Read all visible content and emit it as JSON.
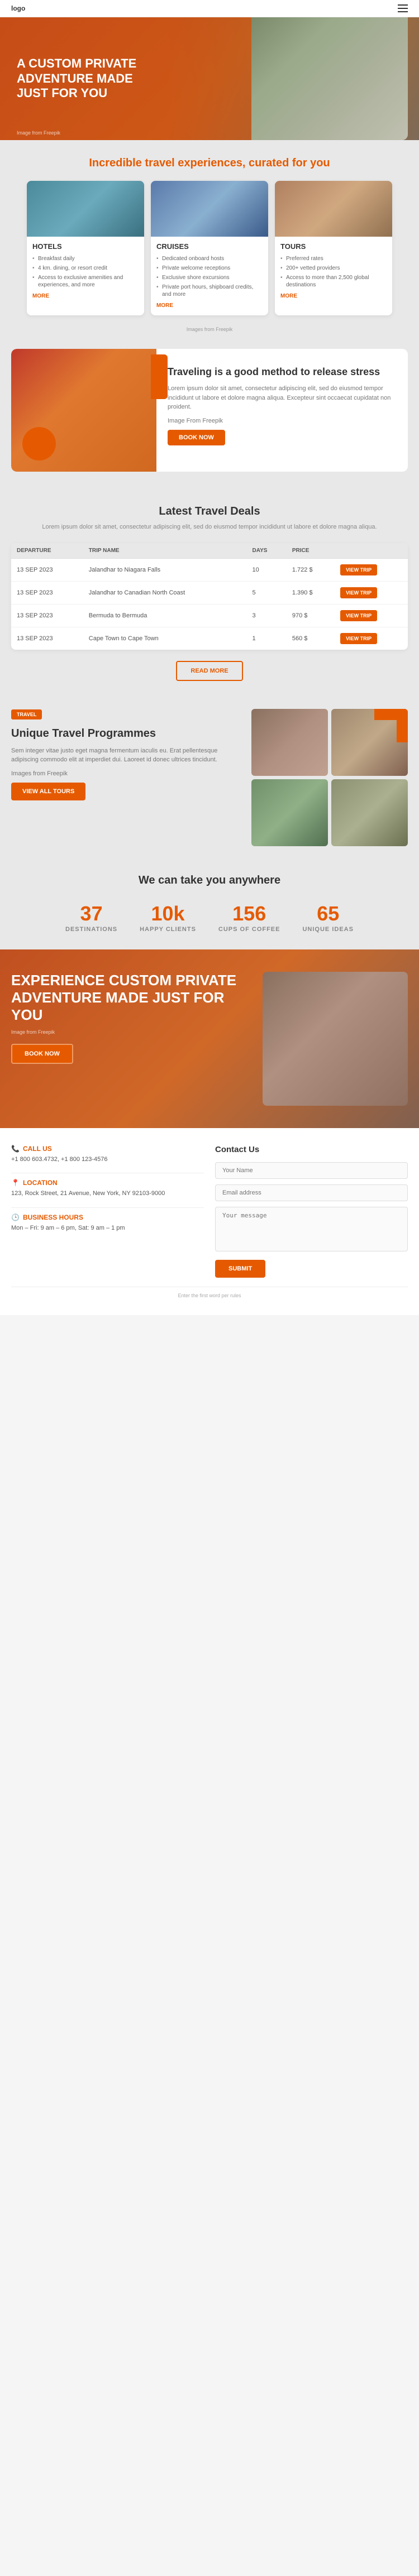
{
  "header": {
    "logo": "logo",
    "menu_icon": "☰"
  },
  "hero": {
    "title": "A CUSTOM PRIVATE ADVENTURE MADE JUST FOR YOU",
    "image_credit": "Image from Freepik"
  },
  "curated": {
    "title_part1": "Incredible travel experiences, curated for",
    "title_part2": "you",
    "cards": [
      {
        "id": "hotels",
        "title": "HOTELS",
        "items": [
          "Breakfast daily",
          "4 km. dining, or resort credit",
          "Access to exclusive amenities and experiences, and more"
        ],
        "more": "MORE"
      },
      {
        "id": "cruises",
        "title": "CRUISES",
        "items": [
          "Dedicated onboard hosts",
          "Private welcome receptions",
          "Exclusive shore excursions",
          "Private port hours, shipboard credits, and more"
        ],
        "more": "MORE"
      },
      {
        "id": "tours",
        "title": "TOURS",
        "items": [
          "Preferred rates",
          "200+ vetted providers",
          "Access to more than 2,500 global destinations"
        ],
        "more": "MORE"
      }
    ],
    "image_credits": "Images from Freepik"
  },
  "stress": {
    "title": "Traveling is a good method to release stress",
    "body": "Lorem ipsum dolor sit amet, consectetur adipiscing elit, sed do eiusmod tempor incididunt ut labore et dolore magna aliqua. Excepteur sint occaecat cupidatat non proident.",
    "image_credit": "Image From Freepik",
    "button": "BOOK NOW"
  },
  "deals": {
    "title": "Latest Travel Deals",
    "subtitle": "Lorem ipsum dolor sit amet, consectetur adipiscing elit, sed do eiusmod tempor incididunt ut labore et dolore magna aliqua.",
    "columns": [
      "DEPARTURE",
      "TRIP NAME",
      "DAYS",
      "PRICE"
    ],
    "rows": [
      {
        "departure": "13 SEP 2023",
        "trip": "Jalandhar to Niagara Falls",
        "days": "10",
        "price": "1.722 $",
        "btn": "VIEW TRIP"
      },
      {
        "departure": "13 SEP 2023",
        "trip": "Jalandhar to Canadian North Coast",
        "days": "5",
        "price": "1.390 $",
        "btn": "VIEW TRIP"
      },
      {
        "departure": "13 SEP 2023",
        "trip": "Bermuda to Bermuda",
        "days": "3",
        "price": "970 $",
        "btn": "VIEW TRIP"
      },
      {
        "departure": "13 SEP 2023",
        "trip": "Cape Town to Cape Town",
        "days": "1",
        "price": "560 $",
        "btn": "VIEW TRIP"
      }
    ],
    "more_button": "READ MORE"
  },
  "unique": {
    "badge": "TRAVEL",
    "title": "Unique Travel Programmes",
    "body": "Sem integer vitae justo eget magna fermentum iaculis eu. Erat pellentesque adipiscing commodo elit at imperdiet dui. Laoreet id donec ultrices tincidunt.",
    "image_credit": "Images from Freepik",
    "button": "VIEW ALL TOURS"
  },
  "stats": {
    "title": "We can take you anywhere",
    "items": [
      {
        "number": "37",
        "label": "DESTINATIONS"
      },
      {
        "number": "10k",
        "label": "HAPPY CLIENTS"
      },
      {
        "number": "156",
        "label": "CUPS OF COFFEE"
      },
      {
        "number": "65",
        "label": "UNIQUE IDEAS"
      }
    ]
  },
  "experience": {
    "title": "Experience Custom Private Adventure Made Just for You",
    "image_credit": "Image from Freepik",
    "button": "BOOK NOW"
  },
  "footer": {
    "contact": {
      "title": "Contact Us",
      "call_label": "CALL US",
      "call_value": "+1 800 603.4732, +1 800 123-4576",
      "location_label": "LOCATION",
      "location_value": "123, Rock Street, 21 Avenue, New York, NY 92103-9000",
      "hours_label": "BUSINESS HOURS",
      "hours_value": "Mon – Fri: 9 am – 6 pm, Sat: 9 am – 1 pm"
    },
    "form": {
      "title": "Contact Us",
      "name_placeholder": "Your Name",
      "email_placeholder": "Email address",
      "message_placeholder": "Your message",
      "submit_label": "SUBMIT"
    },
    "bottom": "Enter the first word per rules"
  }
}
